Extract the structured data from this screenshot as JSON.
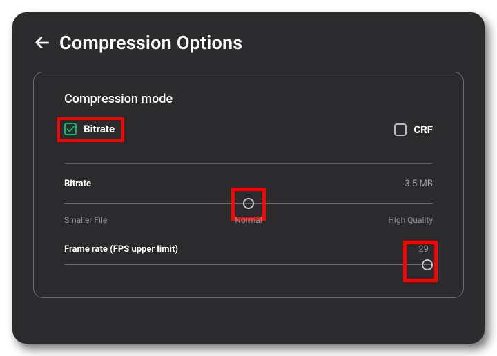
{
  "header": {
    "title": "Compression Options"
  },
  "section": {
    "title": "Compression mode"
  },
  "modes": {
    "bitrate": {
      "label": "Bitrate"
    },
    "crf": {
      "label": "CRF"
    }
  },
  "bitrate_row": {
    "label": "Bitrate",
    "value": "3.5 MB",
    "marks": {
      "left": "Smaller File",
      "mid": "Normal",
      "right": "High Quality"
    }
  },
  "fps_row": {
    "label": "Frame rate (FPS upper limit)",
    "value": "29"
  }
}
